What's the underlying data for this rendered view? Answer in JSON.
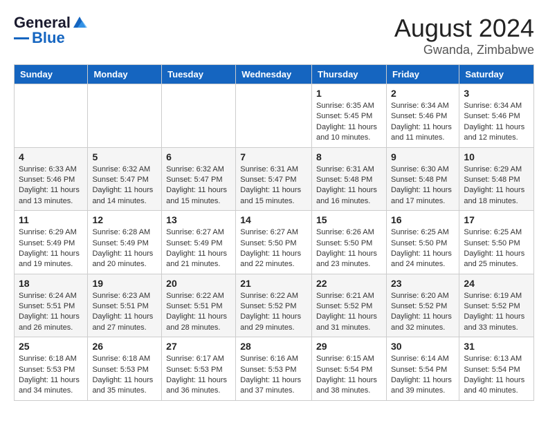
{
  "logo": {
    "general": "General",
    "blue": "Blue"
  },
  "title": "August 2024",
  "location": "Gwanda, Zimbabwe",
  "days_header": [
    "Sunday",
    "Monday",
    "Tuesday",
    "Wednesday",
    "Thursday",
    "Friday",
    "Saturday"
  ],
  "weeks": [
    [
      {
        "day": "",
        "info": ""
      },
      {
        "day": "",
        "info": ""
      },
      {
        "day": "",
        "info": ""
      },
      {
        "day": "",
        "info": ""
      },
      {
        "day": "1",
        "info": "Sunrise: 6:35 AM\nSunset: 5:45 PM\nDaylight: 11 hours and 10 minutes."
      },
      {
        "day": "2",
        "info": "Sunrise: 6:34 AM\nSunset: 5:46 PM\nDaylight: 11 hours and 11 minutes."
      },
      {
        "day": "3",
        "info": "Sunrise: 6:34 AM\nSunset: 5:46 PM\nDaylight: 11 hours and 12 minutes."
      }
    ],
    [
      {
        "day": "4",
        "info": "Sunrise: 6:33 AM\nSunset: 5:46 PM\nDaylight: 11 hours and 13 minutes."
      },
      {
        "day": "5",
        "info": "Sunrise: 6:32 AM\nSunset: 5:47 PM\nDaylight: 11 hours and 14 minutes."
      },
      {
        "day": "6",
        "info": "Sunrise: 6:32 AM\nSunset: 5:47 PM\nDaylight: 11 hours and 15 minutes."
      },
      {
        "day": "7",
        "info": "Sunrise: 6:31 AM\nSunset: 5:47 PM\nDaylight: 11 hours and 15 minutes."
      },
      {
        "day": "8",
        "info": "Sunrise: 6:31 AM\nSunset: 5:48 PM\nDaylight: 11 hours and 16 minutes."
      },
      {
        "day": "9",
        "info": "Sunrise: 6:30 AM\nSunset: 5:48 PM\nDaylight: 11 hours and 17 minutes."
      },
      {
        "day": "10",
        "info": "Sunrise: 6:29 AM\nSunset: 5:48 PM\nDaylight: 11 hours and 18 minutes."
      }
    ],
    [
      {
        "day": "11",
        "info": "Sunrise: 6:29 AM\nSunset: 5:49 PM\nDaylight: 11 hours and 19 minutes."
      },
      {
        "day": "12",
        "info": "Sunrise: 6:28 AM\nSunset: 5:49 PM\nDaylight: 11 hours and 20 minutes."
      },
      {
        "day": "13",
        "info": "Sunrise: 6:27 AM\nSunset: 5:49 PM\nDaylight: 11 hours and 21 minutes."
      },
      {
        "day": "14",
        "info": "Sunrise: 6:27 AM\nSunset: 5:50 PM\nDaylight: 11 hours and 22 minutes."
      },
      {
        "day": "15",
        "info": "Sunrise: 6:26 AM\nSunset: 5:50 PM\nDaylight: 11 hours and 23 minutes."
      },
      {
        "day": "16",
        "info": "Sunrise: 6:25 AM\nSunset: 5:50 PM\nDaylight: 11 hours and 24 minutes."
      },
      {
        "day": "17",
        "info": "Sunrise: 6:25 AM\nSunset: 5:50 PM\nDaylight: 11 hours and 25 minutes."
      }
    ],
    [
      {
        "day": "18",
        "info": "Sunrise: 6:24 AM\nSunset: 5:51 PM\nDaylight: 11 hours and 26 minutes."
      },
      {
        "day": "19",
        "info": "Sunrise: 6:23 AM\nSunset: 5:51 PM\nDaylight: 11 hours and 27 minutes."
      },
      {
        "day": "20",
        "info": "Sunrise: 6:22 AM\nSunset: 5:51 PM\nDaylight: 11 hours and 28 minutes."
      },
      {
        "day": "21",
        "info": "Sunrise: 6:22 AM\nSunset: 5:52 PM\nDaylight: 11 hours and 29 minutes."
      },
      {
        "day": "22",
        "info": "Sunrise: 6:21 AM\nSunset: 5:52 PM\nDaylight: 11 hours and 31 minutes."
      },
      {
        "day": "23",
        "info": "Sunrise: 6:20 AM\nSunset: 5:52 PM\nDaylight: 11 hours and 32 minutes."
      },
      {
        "day": "24",
        "info": "Sunrise: 6:19 AM\nSunset: 5:52 PM\nDaylight: 11 hours and 33 minutes."
      }
    ],
    [
      {
        "day": "25",
        "info": "Sunrise: 6:18 AM\nSunset: 5:53 PM\nDaylight: 11 hours and 34 minutes."
      },
      {
        "day": "26",
        "info": "Sunrise: 6:18 AM\nSunset: 5:53 PM\nDaylight: 11 hours and 35 minutes."
      },
      {
        "day": "27",
        "info": "Sunrise: 6:17 AM\nSunset: 5:53 PM\nDaylight: 11 hours and 36 minutes."
      },
      {
        "day": "28",
        "info": "Sunrise: 6:16 AM\nSunset: 5:53 PM\nDaylight: 11 hours and 37 minutes."
      },
      {
        "day": "29",
        "info": "Sunrise: 6:15 AM\nSunset: 5:54 PM\nDaylight: 11 hours and 38 minutes."
      },
      {
        "day": "30",
        "info": "Sunrise: 6:14 AM\nSunset: 5:54 PM\nDaylight: 11 hours and 39 minutes."
      },
      {
        "day": "31",
        "info": "Sunrise: 6:13 AM\nSunset: 5:54 PM\nDaylight: 11 hours and 40 minutes."
      }
    ]
  ]
}
